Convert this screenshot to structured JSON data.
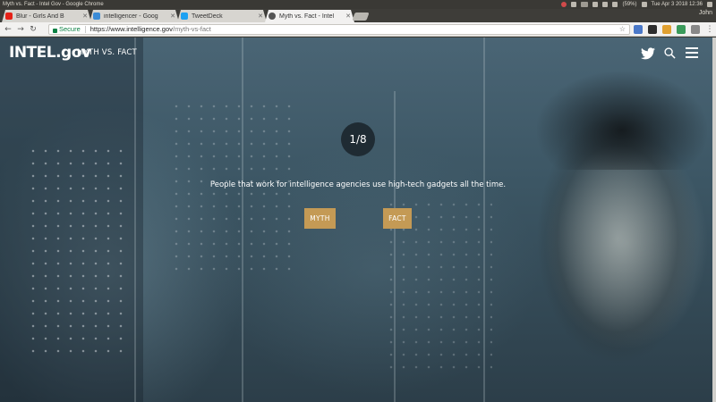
{
  "os": {
    "window_title": "Myth vs. Fact - Intel Gov - Google Chrome",
    "battery": "(59%)",
    "clock": "Tue Apr 3 2018 12:36"
  },
  "browser": {
    "tabs": [
      {
        "label": "Blur - Girls And B",
        "favicon_color": "#e62117"
      },
      {
        "label": "intelligencer - Goog",
        "favicon_color": "#3b8bd6"
      },
      {
        "label": "TweetDeck",
        "favicon_color": "#1da1f2"
      },
      {
        "label": "Myth vs. Fact - Intel",
        "favicon_color": "#555555"
      }
    ],
    "profile_name": "John",
    "secure_label": "Secure",
    "url_host": "https://www.intelligence.gov",
    "url_path": "/myth-vs-fact"
  },
  "site": {
    "logo": "INTEL.gov",
    "section_title": "MYTH VS. FACT",
    "icons": {
      "twitter": "twitter-icon",
      "search": "search-icon",
      "menu": "hamburger-menu-icon"
    }
  },
  "quiz": {
    "counter": "1/8",
    "question": "People that work for intelligence agencies use high-tech gadgets all the time.",
    "myth_label": "MYTH",
    "fact_label": "FACT",
    "button_color": "#c49a55"
  }
}
